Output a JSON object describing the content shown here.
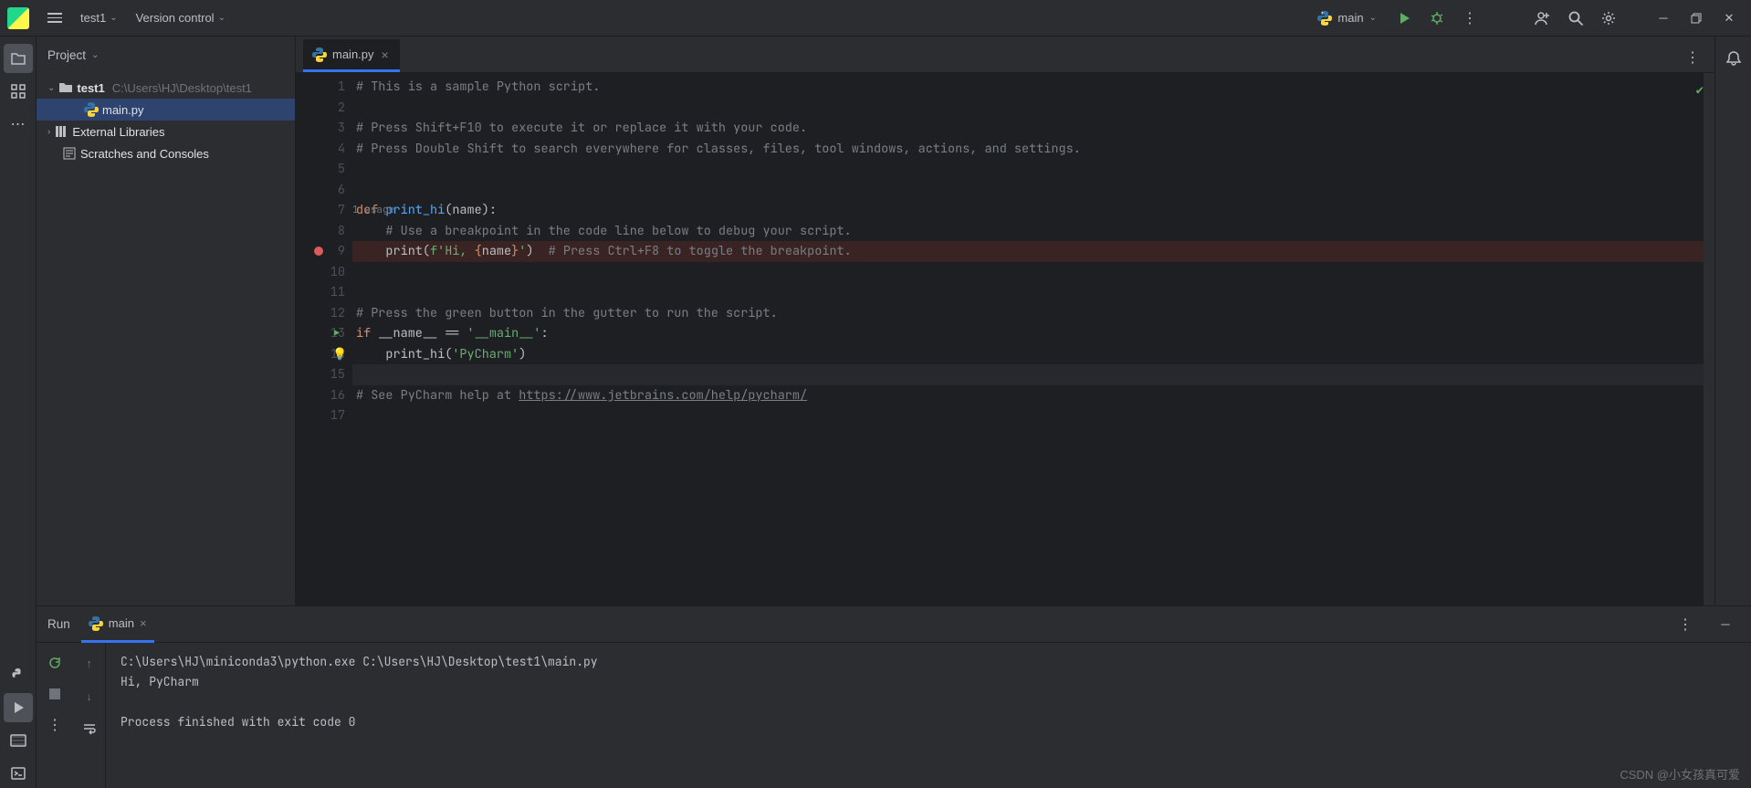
{
  "titlebar": {
    "project": "test1",
    "vcs": "Version control",
    "run_config": "main"
  },
  "project_panel": {
    "title": "Project",
    "root_name": "test1",
    "root_path": "C:\\Users\\HJ\\Desktop\\test1",
    "file": "main.py",
    "ext_lib": "External Libraries",
    "scratches": "Scratches and Consoles"
  },
  "editor": {
    "tab_name": "main.py",
    "usage_hint": "1 usage",
    "lines": [
      {
        "n": 1,
        "html": "<span class='c-comment'># This is a sample Python script.</span>"
      },
      {
        "n": 2,
        "html": ""
      },
      {
        "n": 3,
        "html": "<span class='c-comment'># Press Shift+F10 to execute it or replace it with your code.</span>"
      },
      {
        "n": 4,
        "html": "<span class='c-comment'># Press Double Shift to search everywhere for classes, files, tool windows, actions, and settings.</span>"
      },
      {
        "n": 5,
        "html": ""
      },
      {
        "n": 6,
        "html": ""
      },
      {
        "n": 7,
        "html": "<span class='c-kw'>def </span><span class='c-fn'>print_hi</span>(name):",
        "usage": true
      },
      {
        "n": 8,
        "html": "    <span class='c-comment'># Use a breakpoint in the code line below to debug your script.</span>"
      },
      {
        "n": 9,
        "html": "    print(<span class='c-str'>f'Hi, </span><span class='c-brace'>{</span>name<span class='c-brace'>}</span><span class='c-str'>'</span>)  <span class='c-comment'># Press Ctrl+F8 to toggle the breakpoint.</span>",
        "bp": true
      },
      {
        "n": 10,
        "html": ""
      },
      {
        "n": 11,
        "html": ""
      },
      {
        "n": 12,
        "html": "<span class='c-comment'># Press the green button in the gutter to run the script.</span>"
      },
      {
        "n": 13,
        "html": "<span class='c-kw'>if</span> __name__ == <span class='c-str'>'__main__'</span>:",
        "run": true
      },
      {
        "n": 14,
        "html": "    print_hi(<span class='c-str'>'PyCharm'</span>)",
        "bulb": true
      },
      {
        "n": 15,
        "html": "",
        "current": true
      },
      {
        "n": 16,
        "html": "<span class='c-comment'># See PyCharm help at </span><span class='c-link'>https://www.jetbrains.com/help/pycharm/</span>"
      },
      {
        "n": 17,
        "html": ""
      }
    ]
  },
  "run": {
    "title": "Run",
    "tab": "main",
    "output": "C:\\Users\\HJ\\miniconda3\\python.exe C:\\Users\\HJ\\Desktop\\test1\\main.py\nHi, PyCharm\n\nProcess finished with exit code 0"
  },
  "watermark": "CSDN @小女孩真可爱"
}
